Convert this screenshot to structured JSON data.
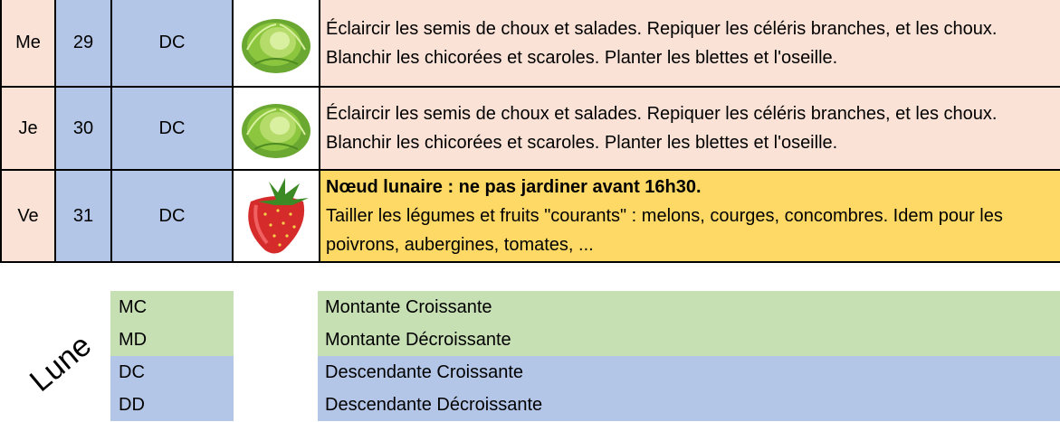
{
  "calendar": {
    "rows": [
      {
        "day": "Me",
        "date": "29",
        "moon": "DC",
        "icon": "cabbage-icon",
        "highlight_title": "",
        "text": "Éclaircir les semis de choux et salades. Repiquer les céléris branches, et les choux. Blanchir les chicorées et scaroles. Planter les blettes et l'oseille."
      },
      {
        "day": "Je",
        "date": "30",
        "moon": "DC",
        "icon": "cabbage-icon",
        "highlight_title": "",
        "text": "Éclaircir les semis de choux et salades. Repiquer les céléris branches, et les choux. Blanchir les chicorées et scaroles. Planter les blettes et l'oseille."
      },
      {
        "day": "Ve",
        "date": "31",
        "moon": "DC",
        "icon": "strawberry-icon",
        "highlight_title": "Nœud lunaire : ne pas jardiner avant 16h30.",
        "text": "Tailler les légumes et fruits \"courants\" : melons, courges, concombres. Idem pour les poivrons, aubergines, tomates, ..."
      }
    ]
  },
  "legend": {
    "title": "Lune",
    "items": [
      {
        "code": "MC",
        "label": "Montante Croissante",
        "color": "#c6e0b4"
      },
      {
        "code": "MD",
        "label": "Montante Décroissante",
        "color": "#c6e0b4"
      },
      {
        "code": "DC",
        "label": "Descendante Croissante",
        "color": "#b4c6e7"
      },
      {
        "code": "DD",
        "label": "Descendante Décroissante",
        "color": "#b4c6e7"
      }
    ]
  },
  "colors": {
    "day_bg": "#fbe2d6",
    "moon_bg": "#b4c6e7",
    "highlight_bg": "#ffd966",
    "green_bg": "#c6e0b4"
  }
}
